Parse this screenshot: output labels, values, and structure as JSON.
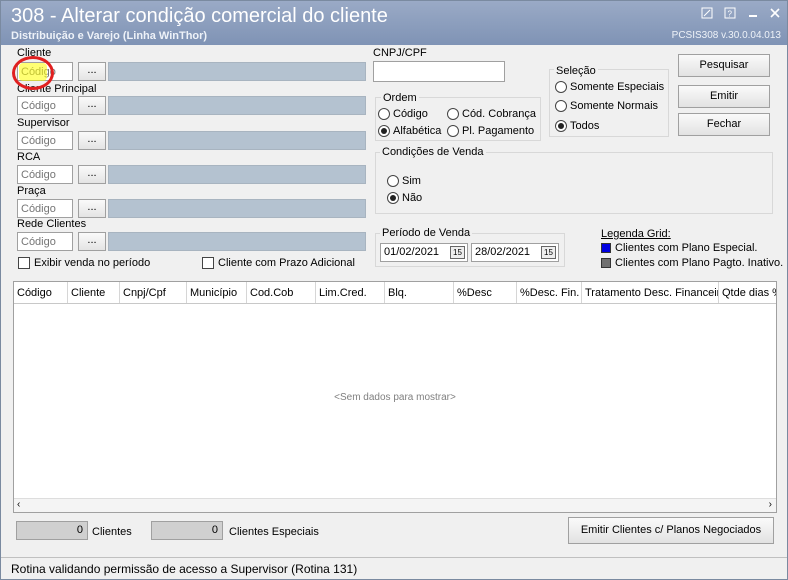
{
  "window": {
    "title": "308 - Alterar condição comercial do cliente",
    "subtitle": "Distribuição e Varejo (Linha WinThor)",
    "version": "PCSIS308  v.30.0.04.013"
  },
  "filters": {
    "cliente_label": "Cliente",
    "cliente_principal_label": "Cliente Principal",
    "supervisor_label": "Supervisor",
    "rca_label": "RCA",
    "praca_label": "Praça",
    "rede_clientes_label": "Rede Clientes",
    "code_placeholder": "Código",
    "dots_label": "...",
    "exibir_venda_label": "Exibir venda no período",
    "prazo_adicional_label": "Cliente com Prazo Adicional"
  },
  "cnpj": {
    "label": "CNPJ/CPF",
    "value": ""
  },
  "ordem": {
    "label": "Ordem",
    "options": [
      "Código",
      "Cód. Cobrança",
      "Alfabética",
      "Pl. Pagamento"
    ],
    "selected": "Alfabética"
  },
  "selecao": {
    "label": "Seleção",
    "options": [
      "Somente Especiais",
      "Somente Normais",
      "Todos"
    ],
    "selected": "Todos"
  },
  "condicoes": {
    "label": "Condições de Venda",
    "options": [
      "Sim",
      "Não"
    ],
    "selected": "Não"
  },
  "periodo": {
    "label": "Período de Venda",
    "start": "01/02/2021",
    "end": "28/02/2021",
    "cal_icon_text": "15"
  },
  "legenda": {
    "label": "Legenda Grid:",
    "items": [
      {
        "text": "Clientes com Plano Especial.",
        "color": "#0000e0"
      },
      {
        "text": "Clientes com Plano Pagto. Inativo.",
        "color": "#707070"
      }
    ]
  },
  "buttons": {
    "pesquisar": "Pesquisar",
    "emitir": "Emitir",
    "fechar": "Fechar",
    "emitir_planos": "Emitir Clientes c/ Planos Negociados"
  },
  "grid": {
    "columns": [
      "Código",
      "Cliente",
      "Cnpj/Cpf",
      "Município",
      "Cod.Cob",
      "Lim.Cred.",
      "Blq.",
      "%Desc",
      "%Desc. Fin.",
      "Tratamento Desc. Financeiro",
      "Qtde dias %"
    ],
    "empty_text": "<Sem dados para mostrar>"
  },
  "footer": {
    "clientes_count": "0",
    "clientes_label": "Clientes",
    "especiais_count": "0",
    "especiais_label": "Clientes Especiais"
  },
  "status": {
    "text": "Rotina validando permissão de acesso a Supervisor (Rotina 131)"
  }
}
